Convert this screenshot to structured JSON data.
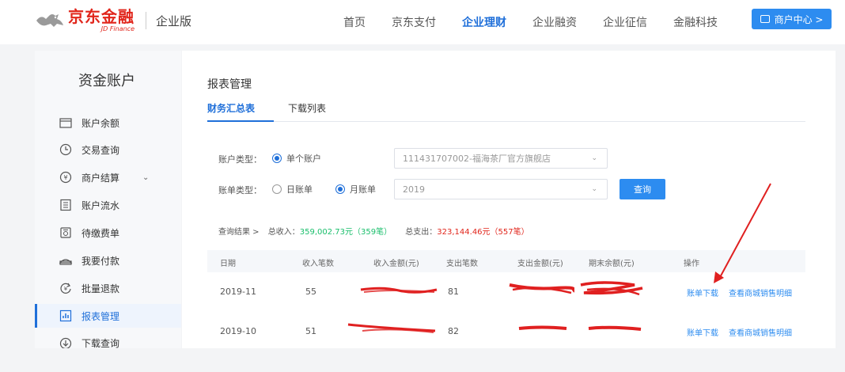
{
  "brand": {
    "name_cn": "京东金融",
    "name_en": "JD Finance",
    "edition": "企业版",
    "brand_color": "#e1251b"
  },
  "nav": {
    "items": [
      {
        "label": "首页",
        "active": false
      },
      {
        "label": "京东支付",
        "active": false
      },
      {
        "label": "企业理财",
        "active": true
      },
      {
        "label": "企业融资",
        "active": false
      },
      {
        "label": "企业征信",
        "active": false
      },
      {
        "label": "金融科技",
        "active": false
      }
    ],
    "merchant_button": "商户中心 >",
    "accent_color": "#2d8cf0"
  },
  "sidebar": {
    "title": "资金账户",
    "items": [
      {
        "label": "账户余额",
        "icon": "wallet-icon"
      },
      {
        "label": "交易查询",
        "icon": "clock-icon"
      },
      {
        "label": "商户结算",
        "icon": "yen-icon",
        "has_submenu": true
      },
      {
        "label": "账户流水",
        "icon": "ledger-icon"
      },
      {
        "label": "待缴费单",
        "icon": "bill-icon"
      },
      {
        "label": "我要付款",
        "icon": "payment-icon"
      },
      {
        "label": "批量退款",
        "icon": "refund-icon"
      },
      {
        "label": "报表管理",
        "icon": "report-chart-icon",
        "active": true
      },
      {
        "label": "下载查询",
        "icon": "download-icon"
      }
    ]
  },
  "main": {
    "title": "报表管理",
    "tabs": [
      {
        "label": "财务汇总表",
        "active": true
      },
      {
        "label": "下载列表",
        "active": false
      }
    ],
    "form": {
      "account_type_label": "账户类型：",
      "account_type_option": "单个账户",
      "account_select_value": "111431707002-福海茶厂官方旗舰店",
      "bill_type_label": "账单类型：",
      "bill_type_options": [
        {
          "label": "日账单",
          "checked": false
        },
        {
          "label": "月账单",
          "checked": true
        }
      ],
      "year_select_value": "2019",
      "query_button": "查询"
    },
    "summary": {
      "label": "查询结果 >",
      "income_label": "总收入：",
      "income_value": "359,002.73元（359笔）",
      "expense_label": "总支出：",
      "expense_value": "323,144.46元（557笔）"
    },
    "table": {
      "headers": [
        "日期",
        "收入笔数",
        "收入金额(元)",
        "支出笔数",
        "支出金额(元)",
        "期末余额(元)",
        "操作"
      ],
      "rows": [
        {
          "date": "2019-11",
          "income_count": "55",
          "expense_count": "81",
          "action_download": "账单下载",
          "action_detail": "查看商城销售明细"
        },
        {
          "date": "2019-10",
          "income_count": "51",
          "expense_count": "82",
          "action_download": "账单下载",
          "action_detail": "查看商城销售明细"
        }
      ]
    }
  }
}
